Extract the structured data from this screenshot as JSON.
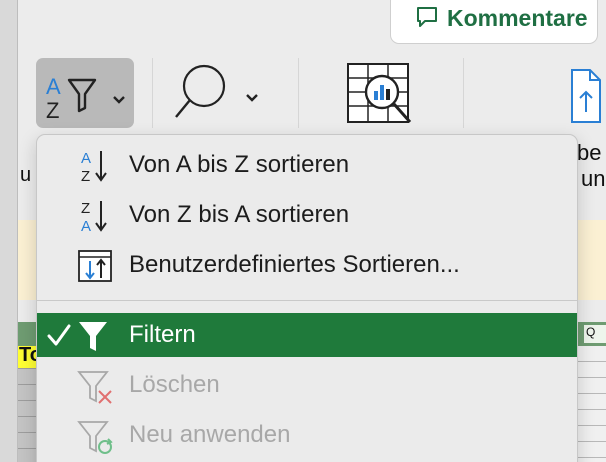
{
  "header": {
    "comment_button_label": "Kommentare"
  },
  "toolbar": {
    "sortfilter_icon": "sort-filter-icon",
    "search_icon": "search-icon",
    "analyze_icon": "analyze-data-icon",
    "share_icon": "share-icon"
  },
  "background_fragments": {
    "right_line1": "be F",
    "right_line2": "un",
    "left_line": "u",
    "sheet_cell": "To",
    "sheet_q": "Q"
  },
  "menu": {
    "items": [
      {
        "label": "Von A bis Z sortieren",
        "icon": "sort-a-to-z-icon",
        "state": "normal"
      },
      {
        "label": "Von Z bis A sortieren",
        "icon": "sort-z-to-a-icon",
        "state": "normal"
      },
      {
        "label": "Benutzerdefiniertes Sortieren...",
        "icon": "custom-sort-icon",
        "state": "normal"
      },
      {
        "label": "Filtern",
        "icon": "filter-icon",
        "state": "checked"
      },
      {
        "label": "Löschen",
        "icon": "clear-filter-icon",
        "state": "disabled"
      },
      {
        "label": "Neu anwenden",
        "icon": "reapply-filter-icon",
        "state": "disabled"
      }
    ]
  },
  "colors": {
    "accent_green": "#1f7a3b",
    "brand_green": "#1f6f43",
    "menu_background": "#ebebeb",
    "disabled_text": "#a8a8a8"
  }
}
